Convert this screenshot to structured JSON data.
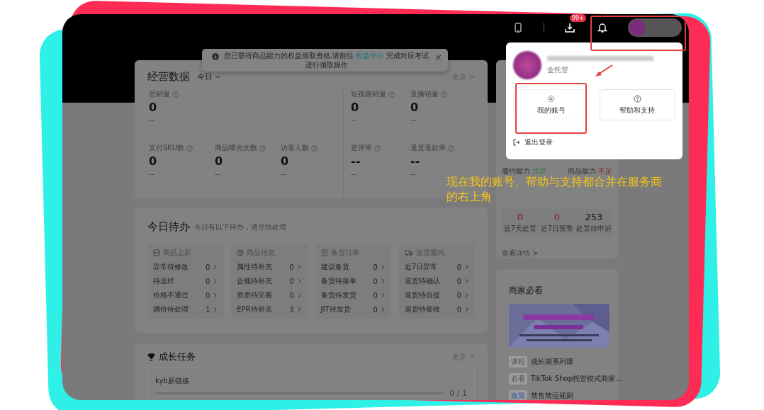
{
  "topbar": {
    "download_badge": "99+"
  },
  "notice": {
    "text": "您已获得商品能力的权益领取资格,请前往 ",
    "link": "权益中心",
    "text_after": " 完成对应考试进行领取操作",
    "close": "×"
  },
  "account_menu": {
    "role": "全托管",
    "buttons": [
      {
        "kind": "settings",
        "label": "我的账号",
        "highlighted": true
      },
      {
        "kind": "help",
        "label": "帮助和支持",
        "highlighted": false
      }
    ],
    "logout": "退出登录"
  },
  "annotation": {
    "text": "现在我的账号、帮助与支持都合并在服务商的右上角"
  },
  "business_data": {
    "title": "经营数据",
    "period": "今日",
    "more": "更多 >",
    "metrics": [
      {
        "label": "总销量",
        "value": "0",
        "change": "--"
      },
      {
        "label": "短视频销量",
        "value": "0",
        "change": "--"
      },
      {
        "label": "直播销量",
        "value": "0",
        "change": "--"
      },
      {
        "label": "支付SKU数",
        "value": "0",
        "change": "--"
      },
      {
        "label": "商品曝光次数",
        "value": "0",
        "change": "--"
      },
      {
        "label": "访客人数",
        "value": "0",
        "change": "--"
      },
      {
        "label": "差评率",
        "value": "--",
        "change": "--"
      },
      {
        "label": "退货退款率",
        "value": "--",
        "change": "--"
      }
    ]
  },
  "todo": {
    "title": "今日待办",
    "subtitle": "今日有以下待办，请尽快处理",
    "groups": [
      {
        "kind": "listing",
        "title": "商品上新",
        "rows": [
          {
            "label": "异常待修改",
            "count": "0"
          },
          {
            "label": "待送样",
            "count": "0"
          },
          {
            "label": "价格不通过",
            "count": "0"
          },
          {
            "label": "调价待处理",
            "count": "1"
          }
        ]
      },
      {
        "kind": "product",
        "title": "商品信息",
        "rows": [
          {
            "label": "属性待补充",
            "count": "0"
          },
          {
            "label": "合规待补充",
            "count": "0"
          },
          {
            "label": "资质待完善",
            "count": "0"
          },
          {
            "label": "EPR待补充",
            "count": "3"
          }
        ]
      },
      {
        "kind": "order",
        "title": "备货订单",
        "rows": [
          {
            "label": "建议备货",
            "count": "0"
          },
          {
            "label": "备货待接单",
            "count": "0"
          },
          {
            "label": "备货待发货",
            "count": "0"
          },
          {
            "label": "JIT待发货",
            "count": "0"
          }
        ]
      },
      {
        "kind": "delivery",
        "title": "送货履约",
        "rows": [
          {
            "label": "近7日异常",
            "count": "0"
          },
          {
            "label": "退货待确认",
            "count": "0"
          },
          {
            "label": "退货待自提",
            "count": "0"
          },
          {
            "label": "退货待签收",
            "count": "0"
          }
        ]
      }
    ]
  },
  "growth": {
    "title": "成长任务",
    "more": "更多 >",
    "task": {
      "name": "kyb新链接",
      "progress": "0 / 1",
      "level": 0
    }
  },
  "ability": {
    "items": [
      {
        "label": "履约能力",
        "grade": "优异",
        "good": true
      },
      {
        "label": "商品能力",
        "grade": "不足",
        "good": false
      }
    ],
    "stats": [
      {
        "value": "0",
        "label": "近7天处置",
        "alert": true
      },
      {
        "value": "0",
        "label": "近7日预警",
        "alert": true
      },
      {
        "value": "253",
        "label": "处置待申诉",
        "alert": false
      }
    ],
    "link": "查看详情 >"
  },
  "must_read": {
    "title": "商家必看",
    "items": [
      {
        "tag": "课程",
        "color": "#4f4f4f",
        "title": "成长期系列课"
      },
      {
        "tag": "必看",
        "color": "#4f4f4f",
        "title": "TikTok Shop托管模式商家..."
      },
      {
        "tag": "政策",
        "color": "#2d52a0",
        "title": "禁售禁运规则"
      }
    ]
  }
}
